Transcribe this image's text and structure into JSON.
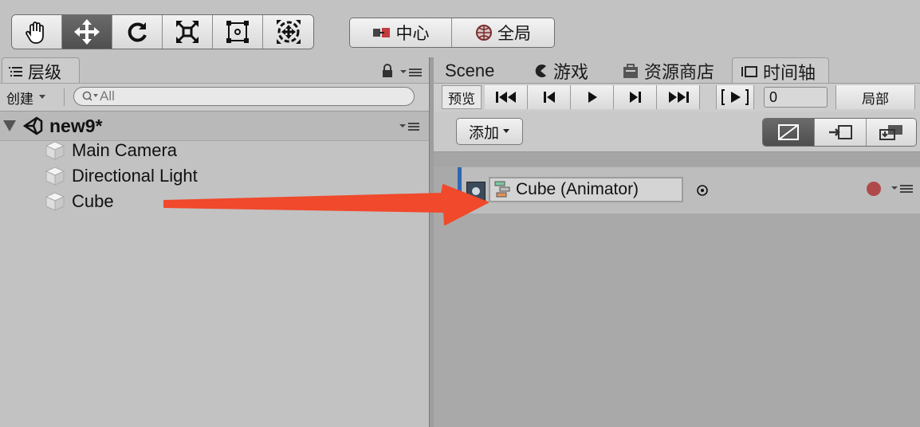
{
  "toolbar": {
    "tools": [
      {
        "icon": "hand-tool-icon",
        "active": false
      },
      {
        "icon": "move-tool-icon",
        "active": true
      },
      {
        "icon": "rotate-tool-icon",
        "active": false
      },
      {
        "icon": "scale-tool-icon",
        "active": false
      },
      {
        "icon": "rect-tool-icon",
        "active": false
      },
      {
        "icon": "transform-tool-icon",
        "active": false
      }
    ],
    "pivot_label": "中心",
    "global_label": "全局"
  },
  "hierarchy": {
    "tab_label": "层级",
    "create_label": "创建",
    "search_placeholder": "All",
    "scene_name": "new9*",
    "items": [
      {
        "label": "Main Camera"
      },
      {
        "label": "Directional Light"
      },
      {
        "label": "Cube"
      }
    ]
  },
  "right": {
    "tabs": [
      {
        "label": "Scene",
        "icon": ""
      },
      {
        "label": "游戏",
        "icon": "game-icon"
      },
      {
        "label": "资源商店",
        "icon": "store-icon"
      },
      {
        "label": "时间轴",
        "icon": "timeline-icon"
      }
    ],
    "preview_label": "预览",
    "frame_value": "0",
    "local_label": "局部",
    "add_label": "添加",
    "track_label": "Cube (Animator)"
  },
  "colors": {
    "arrow": "#f0492c",
    "record": "#b04a4a",
    "track_accent": "#2f66b5"
  }
}
